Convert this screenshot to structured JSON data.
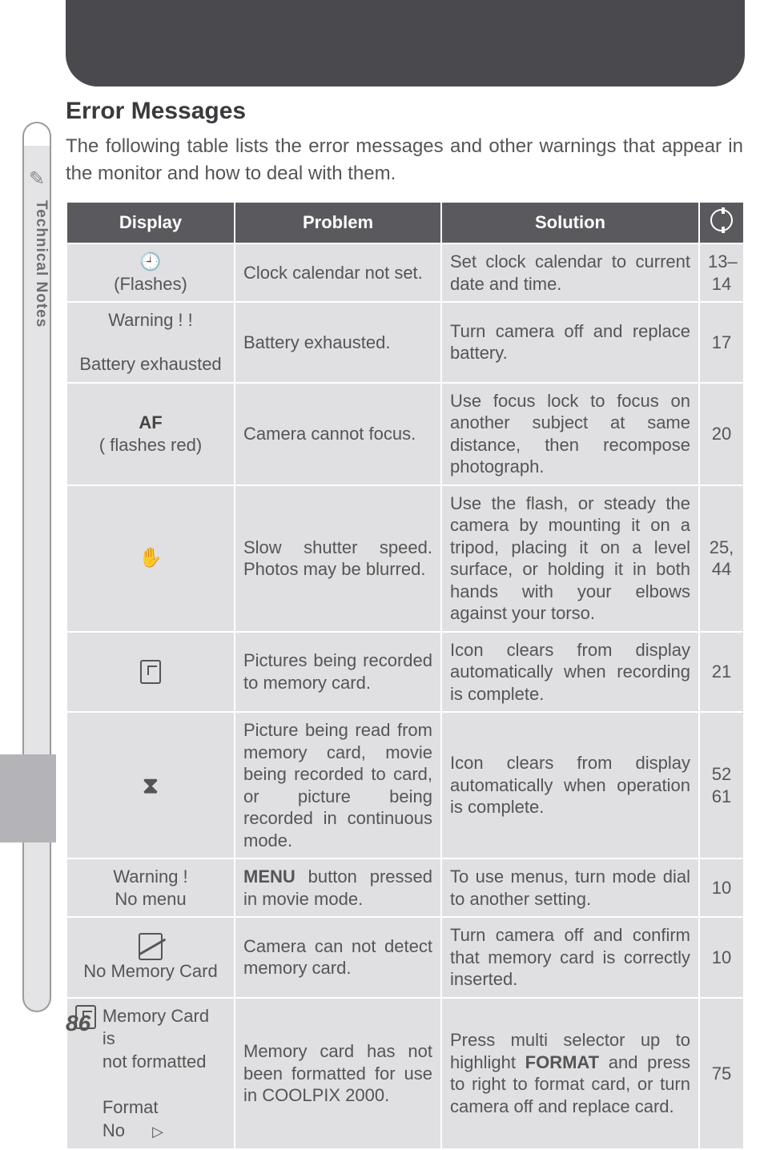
{
  "side_tab": {
    "label": "Technical Notes"
  },
  "title": "Error Messages",
  "intro": "The following table lists the error messages and other warnings that appear in the monitor and how to deal with them.",
  "headers": {
    "display": "Display",
    "problem": "Problem",
    "solution": "Solution",
    "page_icon": "page-ref-icon"
  },
  "rows": [
    {
      "display_icon": "clock-icon",
      "display_text": "(Flashes)",
      "problem": "Clock calendar not set.",
      "solution": "Set clock calendar to current date and time.",
      "page": "13–14"
    },
    {
      "display_lines": [
        "Warning ! !",
        "",
        "Battery exhausted"
      ],
      "problem": "Battery exhausted.",
      "solution": "Turn camera off and replace battery.",
      "page": "17"
    },
    {
      "display_bold": "AF",
      "display_paren": "(      flashes red)",
      "problem": "Camera cannot focus.",
      "solution": "Use focus lock to focus on another subject at same distance, then recompose photograph.",
      "page": "20"
    },
    {
      "display_icon": "hand-icon",
      "problem": "Slow shutter speed. Photos may be blurred.",
      "solution": "Use the flash, or steady the camera by mounting it on a tripod, placing it on a level surface, or holding it in both hands with your elbows against your torso.",
      "page": "25, 44"
    },
    {
      "display_icon": "card-record-icon",
      "problem": "Pictures being recorded to memory card.",
      "solution": "Icon clears from display automatically when recording is complete.",
      "page": "21"
    },
    {
      "display_icon": "hourglass-icon",
      "problem": "Picture being read from memory card, movie being recorded to card, or picture being recorded in continuous mode.",
      "solution": "Icon clears from display automatically when operation is complete.",
      "page": "52 61"
    },
    {
      "display_lines": [
        "Warning !",
        "No menu"
      ],
      "problem_prefix_bold": "MENU",
      "problem_rest": " button pressed in movie mode.",
      "solution": "To use menus, turn mode dial to another setting.",
      "page": "10"
    },
    {
      "display_icon": "no-card-icon",
      "display_text_below": "No Memory Card",
      "problem": "Camera can not detect memory card.",
      "solution": "Turn camera off and confirm that memory card is correctly inserted.",
      "page": "10"
    },
    {
      "display_icon_left": "card-icon",
      "display_right_lines": [
        "Memory Card is",
        "not formatted",
        "",
        "Format",
        "No"
      ],
      "display_triangle": "▷",
      "problem": "Memory card has not been formatted for use in COOLPIX 2000.",
      "solution_prefix": "Press multi selector up to highlight ",
      "solution_bold": "FORMAT",
      "solution_rest": " and press to right to format card, or turn camera off and replace card.",
      "page": "75"
    }
  ],
  "page_number": "86"
}
